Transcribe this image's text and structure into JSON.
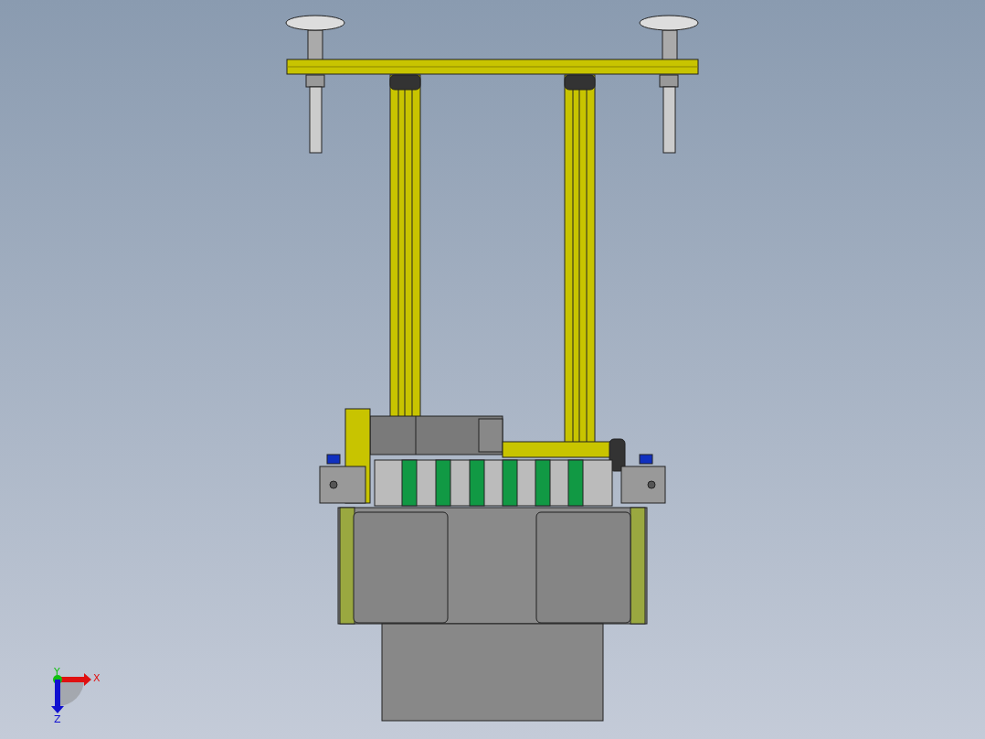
{
  "viewport": {
    "triad": {
      "axes": [
        {
          "label": "X",
          "kind": "x",
          "color": "#e01010"
        },
        {
          "label": "Y",
          "kind": "y",
          "color": "#10c010"
        },
        {
          "label": "Z",
          "kind": "z",
          "color": "#1010d0"
        }
      ]
    }
  }
}
